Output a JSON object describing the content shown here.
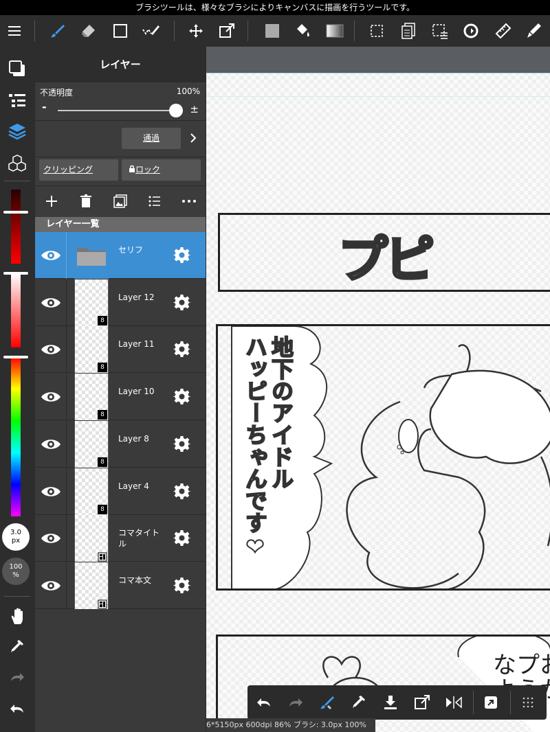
{
  "hint": "ブラシツールは、様々なブラシによりキャンバスに描画を行うツールです。",
  "toolbar": {
    "tools": [
      "menu-icon",
      "brush-icon",
      "eraser-icon",
      "rectangle-icon",
      "selection-pen-icon",
      "move-icon",
      "transform-icon",
      "fill-color-icon",
      "bucket-icon",
      "gradient-icon",
      "select-icon",
      "layer-stack-icon",
      "select-menu-icon",
      "rotate-icon",
      "ruler-icon",
      "pen-settings-icon"
    ]
  },
  "panel": {
    "title": "レイヤー",
    "opacity_label": "不透明度",
    "opacity_value": "100%",
    "opacity_minus": "-",
    "opacity_plus": "±",
    "opacity": 1.0,
    "blend_mode": "通過",
    "clipping": "クリッピング",
    "lock": "ロック",
    "list_title": "レイヤー一覧",
    "layers": [
      {
        "name": "セリフ",
        "selected": true,
        "folder": true,
        "badge": ""
      },
      {
        "name": "Layer 12",
        "selected": false,
        "folder": false,
        "badge": "8"
      },
      {
        "name": "Layer 11",
        "selected": false,
        "folder": false,
        "badge": "8"
      },
      {
        "name": "Layer 10",
        "selected": false,
        "folder": false,
        "badge": "8"
      },
      {
        "name": "Layer 8",
        "selected": false,
        "folder": false,
        "badge": "8"
      },
      {
        "name": "Layer 4",
        "selected": false,
        "folder": false,
        "badge": "8"
      },
      {
        "name": "コマタイトル",
        "selected": false,
        "folder": false,
        "badge": ""
      },
      {
        "name": "コマ本文",
        "selected": false,
        "folder": false,
        "badge": ""
      }
    ]
  },
  "brush": {
    "size_value": "3.0",
    "size_unit": "px",
    "opacity_value": "100",
    "opacity_unit": "%"
  },
  "canvas": {
    "title_text": "プピ",
    "bubble_text": [
      "地下のアイドル",
      "ハッピーちゃんです❤"
    ],
    "bottom_text": "なプお\nようか"
  },
  "status": "6*5150px 600dpi 86% ブラシ: 3.0px 100%",
  "colors": {
    "accent": "#3d8fd4",
    "panel": "#3a3a3a"
  }
}
